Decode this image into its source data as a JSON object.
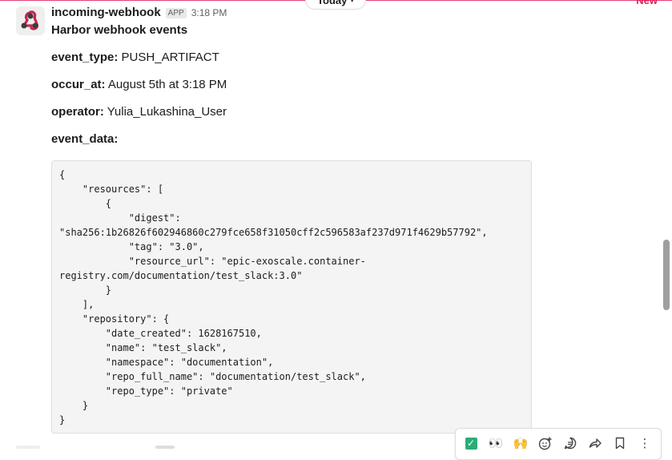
{
  "date_divider": {
    "label": "Today",
    "new_label": "New"
  },
  "message": {
    "sender": "incoming-webhook",
    "app_badge": "APP",
    "time": "3:18 PM",
    "title": "Harbor webhook events",
    "fields": [
      {
        "key": "event_type:",
        "value": "PUSH_ARTIFACT"
      },
      {
        "key": "occur_at:",
        "value": "August 5th at 3:18 PM"
      },
      {
        "key": "operator:",
        "value": "Yulia_Lukashina_User"
      },
      {
        "key": "event_data:",
        "value": ""
      }
    ],
    "code": "{\n    \"resources\": [\n        {\n            \"digest\":\n\"sha256:1b26826f602946860c279fce658f31050cff2c596583af237d971f4629b57792\",\n            \"tag\": \"3.0\",\n            \"resource_url\": \"epic-exoscale.container-\nregistry.com/documentation/test_slack:3.0\"\n        }\n    ],\n    \"repository\": {\n        \"date_created\": 1628167510,\n        \"name\": \"test_slack\",\n        \"namespace\": \"documentation\",\n        \"repo_full_name\": \"documentation/test_slack\",\n        \"repo_type\": \"private\"\n    }\n}"
  },
  "actions": {
    "items": [
      {
        "name": "react-check-button",
        "glyph": "✓"
      },
      {
        "name": "react-eyes-button",
        "glyph": "👀"
      },
      {
        "name": "react-raised-hands-button",
        "glyph": "🙌"
      },
      {
        "name": "add-reaction-button",
        "glyph": "☺"
      },
      {
        "name": "reply-thread-button",
        "glyph": "💬"
      },
      {
        "name": "share-message-button",
        "glyph": "↪"
      },
      {
        "name": "save-message-button",
        "glyph": "🔖"
      },
      {
        "name": "more-actions-button",
        "glyph": "⋮"
      }
    ]
  },
  "colors": {
    "accent_red": "#e01e5a",
    "check_green": "#2bac76"
  }
}
